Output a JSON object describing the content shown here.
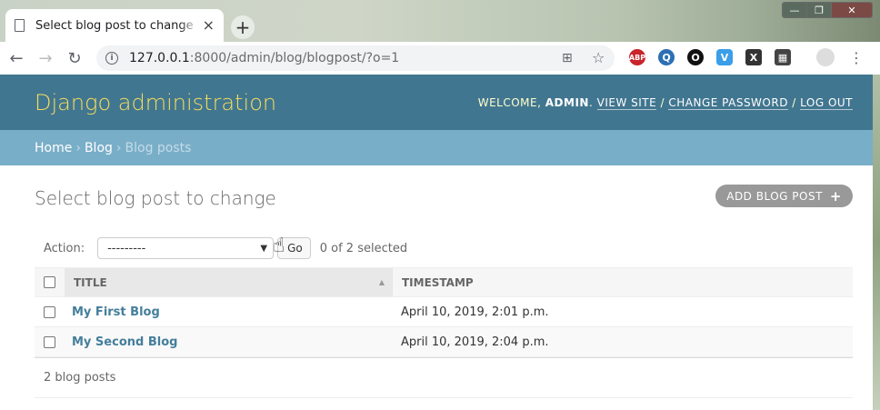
{
  "browser": {
    "tab_title": "Select blog post to change | Django site admin",
    "tab_close": "×",
    "new_tab": "+",
    "url_host": "127.0.0.1",
    "url_rest": ":8000/admin/blog/blogpost/?o=1",
    "window_controls": [
      "—",
      "❐",
      "✕"
    ],
    "extensions": [
      "ABP",
      "Q",
      "O",
      "V",
      "X",
      "▦"
    ]
  },
  "admin": {
    "branding": "Django administration",
    "welcome": "WELCOME,",
    "username": "ADMIN",
    "view_site": "VIEW SITE",
    "change_password": "CHANGE PASSWORD",
    "log_out": "LOG OUT"
  },
  "breadcrumbs": {
    "home": "Home",
    "app": "Blog",
    "current": "Blog posts",
    "separator": "›"
  },
  "page": {
    "title": "Select blog post to change",
    "add_button": "ADD BLOG POST",
    "add_plus": "+"
  },
  "actions": {
    "label": "Action:",
    "selected_option": "---------",
    "go_label": "Go",
    "counter": "0 of 2 selected"
  },
  "table": {
    "columns": [
      "Title",
      "Timestamp"
    ],
    "rows": [
      {
        "title": "My First Blog",
        "timestamp": "April 10, 2019, 2:01 p.m."
      },
      {
        "title": "My Second Blog",
        "timestamp": "April 10, 2019, 2:04 p.m."
      }
    ],
    "footer": "2 blog posts"
  }
}
